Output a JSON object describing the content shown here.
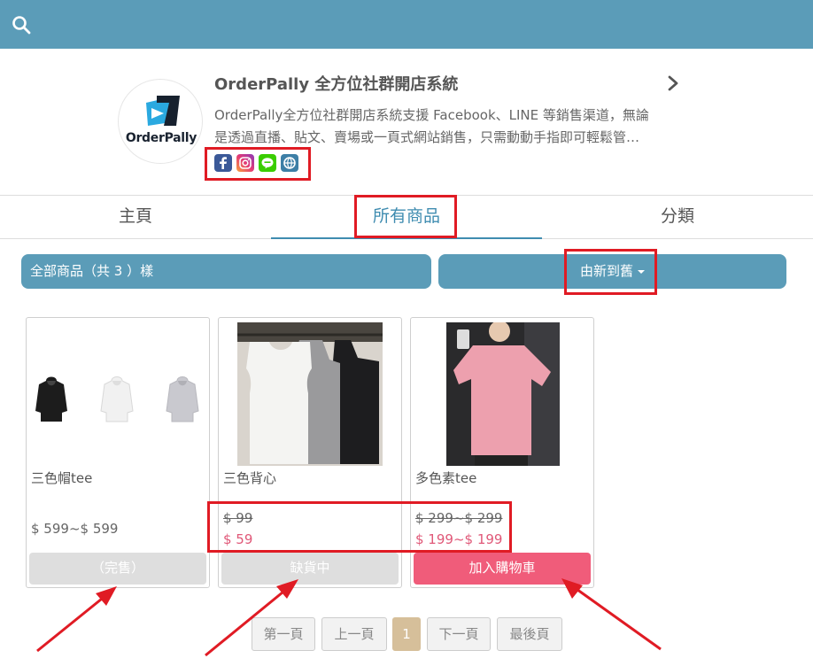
{
  "header": {
    "search_icon": "search-icon",
    "bg_color": "#5b9cb8"
  },
  "shop": {
    "logo_text": "OrderPally",
    "name": "OrderPally 全方位社群開店系統",
    "description_line1": "OrderPally全方位社群開店系統支援 Facebook、LINE 等銷售渠道，無論",
    "description_line2": "是透過直播、貼文、賣場或一頁式網站銷售，只需動動手指即可輕鬆管…",
    "social_icons": [
      "facebook-icon",
      "instagram-icon",
      "line-icon",
      "website-icon"
    ]
  },
  "tabs": [
    {
      "label": "主頁",
      "active": false
    },
    {
      "label": "所有商品",
      "active": true
    },
    {
      "label": "分類",
      "active": false
    }
  ],
  "filter": {
    "count_label": "全部商品（共 3 ）樣",
    "sort_label": "由新到舊"
  },
  "products": [
    {
      "name": "三色帽tee",
      "price": "$ 599~$ 599",
      "button": "（完售）",
      "button_state": "disabled"
    },
    {
      "name": "三色背心",
      "original_price": "$ 99",
      "sale_price": "$ 59",
      "button": "缺貨中",
      "button_state": "disabled"
    },
    {
      "name": "多色素tee",
      "original_price": "$ 299~$ 299",
      "sale_price": "$ 199~$ 199",
      "button": "加入購物車",
      "button_state": "active"
    }
  ],
  "pagination": {
    "first": "第一頁",
    "prev": "上一頁",
    "current": "1",
    "next": "下一頁",
    "last": "最後頁"
  },
  "colors": {
    "accent": "#5b9cb8",
    "tab_active": "#3f8cb0",
    "sale_price": "#e05878",
    "cart_button": "#f05c7a",
    "annotation_red": "#e01b24",
    "page_current": "#d6bf9a"
  }
}
